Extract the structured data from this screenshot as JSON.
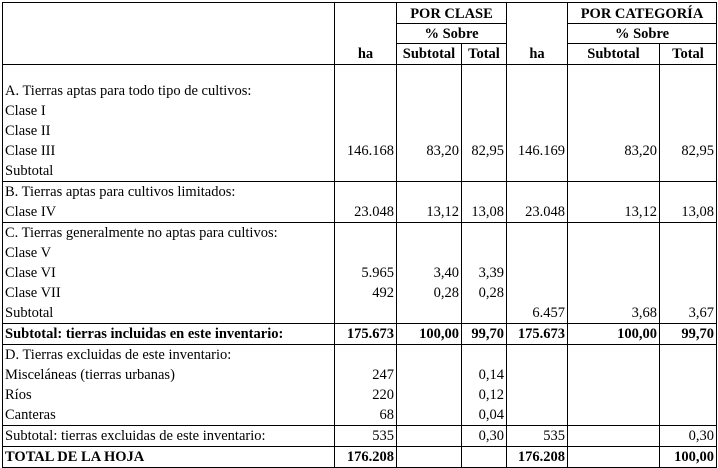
{
  "header": {
    "ha": "ha",
    "por_clase": "POR CLASE",
    "pct_sobre": "% Sobre",
    "por_categoria": "POR CATEGORÍA",
    "subtotal": "Subtotal",
    "total": "Total"
  },
  "sections": {
    "a": {
      "lines": [
        "A. Tierras aptas para todo tipo de cultivos:",
        "Clase I",
        "Clase II",
        "Clase III",
        "Subtotal"
      ],
      "clase_ha": "146.168",
      "clase_sub": "83,20",
      "clase_tot": "82,95",
      "cat_ha": "146.169",
      "cat_sub": "83,20",
      "cat_tot": "82,95"
    },
    "b": {
      "lines": [
        "B. Tierras aptas para cultivos limitados:",
        "Clase IV"
      ],
      "clase_ha": "23.048",
      "clase_sub": "13,12",
      "clase_tot": "13,08",
      "cat_ha": "23.048",
      "cat_sub": "13,12",
      "cat_tot": "13,08"
    },
    "c": {
      "lines": [
        "C. Tierras generalmente no aptas para cultivos:",
        "Clase V",
        "Clase VI",
        "Clase VII",
        "Subtotal"
      ],
      "vi_ha": "5.965",
      "vi_sub": "3,40",
      "vi_tot": "3,39",
      "vii_ha": "492",
      "vii_sub": "0,28",
      "vii_tot": "0,28",
      "cat_ha": "6.457",
      "cat_sub": "3,68",
      "cat_tot": "3,67"
    },
    "subtotal_incluidas": {
      "label": "Subtotal: tierras incluidas en este inventario:",
      "clase_ha": "175.673",
      "clase_sub": "100,00",
      "clase_tot": "99,70",
      "cat_ha": "175.673",
      "cat_sub": "100,00",
      "cat_tot": "99,70"
    },
    "d": {
      "lines": [
        "D. Tierras excluidas de este inventario:",
        "Misceláneas (tierras urbanas)",
        "Ríos",
        "Canteras"
      ],
      "ha": [
        "247",
        "220",
        "68"
      ],
      "tot": [
        "0,14",
        "0,12",
        "0,04"
      ]
    },
    "subtotal_excluidas": {
      "label": "Subtotal: tierras excluidas de este inventario:",
      "clase_ha": "535",
      "clase_tot": "0,30",
      "cat_ha": "535",
      "cat_tot": "0,30"
    },
    "total_hoja": {
      "label": "TOTAL DE LA HOJA",
      "clase_ha": "176.208",
      "cat_ha": "176.208",
      "cat_tot": "100,00"
    }
  }
}
